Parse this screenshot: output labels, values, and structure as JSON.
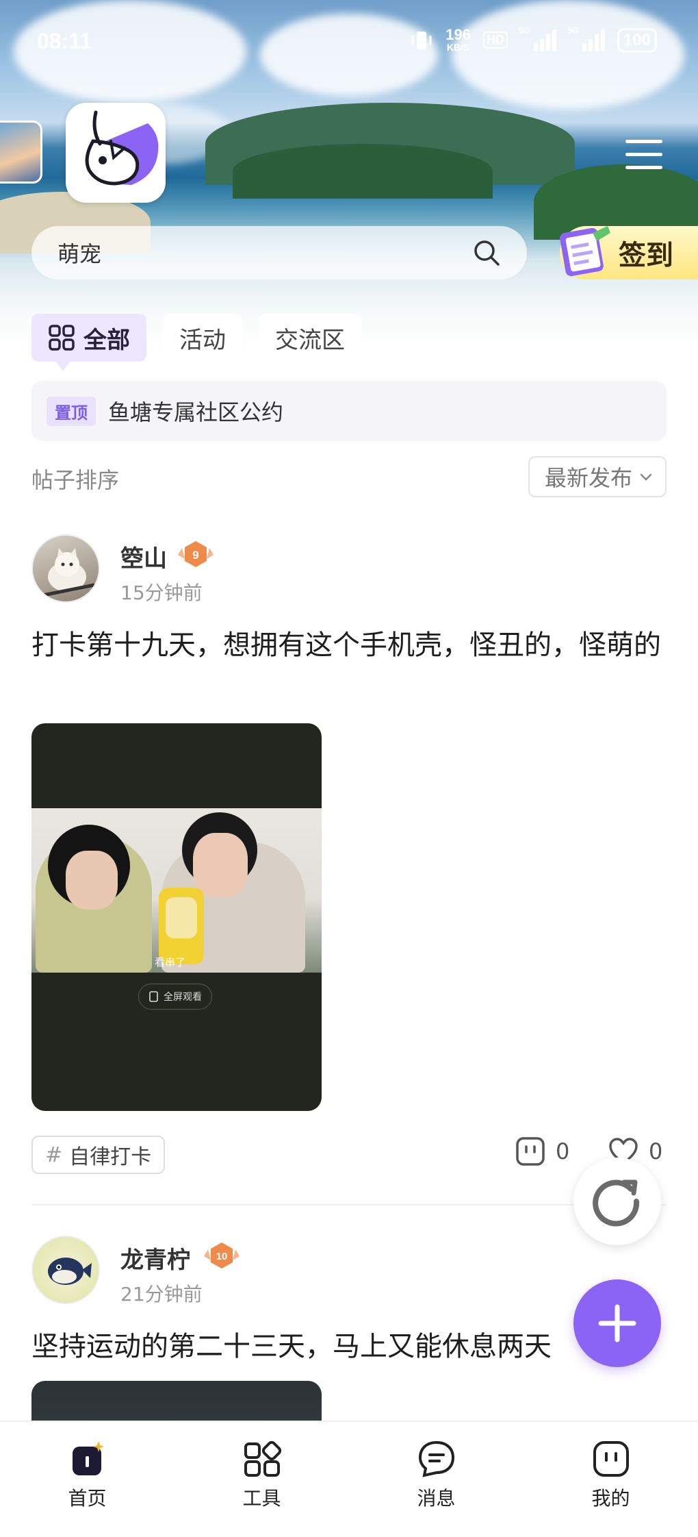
{
  "status_bar": {
    "time": "08:11",
    "net_speed_value": "196",
    "net_speed_unit": "KB/S",
    "hd_label": "HD",
    "signal1_label": "5G",
    "signal2_label": "5G",
    "battery": "100"
  },
  "search": {
    "value": "萌宠"
  },
  "checkin": {
    "label": "签到"
  },
  "tabs": [
    {
      "label": "全部",
      "active": true
    },
    {
      "label": "活动",
      "active": false
    },
    {
      "label": "交流区",
      "active": false
    }
  ],
  "pinned": {
    "badge": "置顶",
    "text": "鱼塘专属社区公约"
  },
  "sort": {
    "label": "帖子排序",
    "selected": "最新发布"
  },
  "posts": [
    {
      "username": "箜山",
      "level": "9",
      "time": "15分钟前",
      "text": "打卡第十九天，想拥有这个手机壳，怪丑的，怪萌的",
      "image_caption": "看串了",
      "image_button": "全屏观看",
      "tag": "自律打卡",
      "comments": "0",
      "likes": "0"
    },
    {
      "username": "龙青柠",
      "level": "10",
      "time": "21分钟前",
      "text": "坚持运动的第二十三天，马上又能休息两天"
    }
  ],
  "bottom_nav": [
    {
      "label": "首页",
      "icon": "home-icon",
      "active": true
    },
    {
      "label": "工具",
      "icon": "tools-icon",
      "active": false
    },
    {
      "label": "消息",
      "icon": "message-icon",
      "active": false
    },
    {
      "label": "我的",
      "icon": "profile-icon",
      "active": false
    }
  ],
  "colors": {
    "accent": "#8b63f5",
    "tab_active_bg": "#ece7ff",
    "checkin_bg": "#ffe680"
  }
}
